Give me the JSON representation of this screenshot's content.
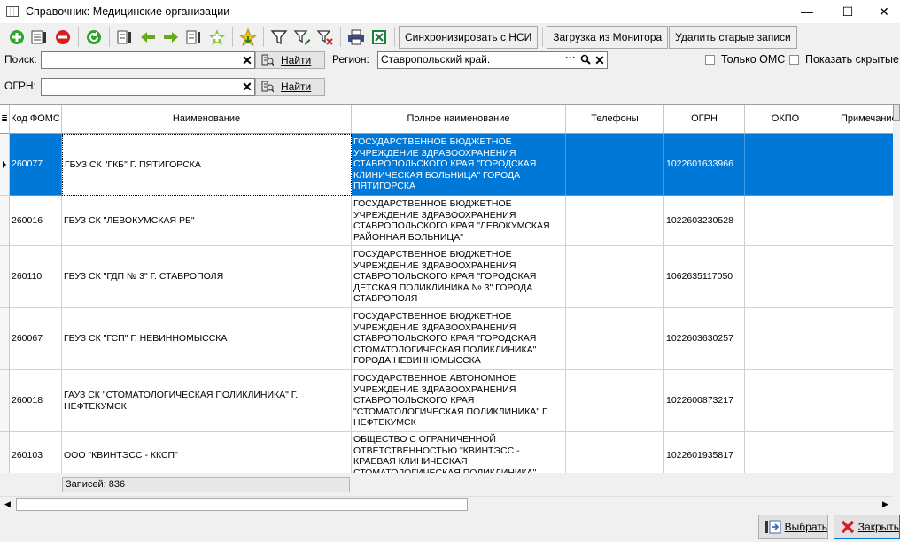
{
  "window": {
    "title": "Справочник: Медицинские организации",
    "minimize": "—",
    "maximize": "☐",
    "close": "✕"
  },
  "toolbar": {
    "sync_label": "Синхронизировать с НСИ",
    "monitor_label": "Загрузка из Монитора",
    "delete_old_label": "Удалить старые записи"
  },
  "filters": {
    "search_label": "Поиск:",
    "search_value": "",
    "find_label": "Найти",
    "region_label": "Регион:",
    "region_value": "Ставропольский край.",
    "region_dots": "···",
    "only_oms_label": "Только ОМС",
    "show_hidden_label": "Показать скрытые",
    "ogrn_label": "ОГРН:",
    "ogrn_value": "",
    "find2_label": "Найти"
  },
  "table": {
    "columns": [
      "Код ФОМС",
      "Наименование",
      "Полное наименование",
      "Телефоны",
      "ОГРН",
      "ОКПО",
      "Примечание"
    ],
    "rows": [
      {
        "code": "260077",
        "name": "ГБУЗ СК \"ГКБ\" Г. ПЯТИГОРСКА",
        "full": "ГОСУДАРСТВЕННОЕ БЮДЖЕТНОЕ УЧРЕЖДЕНИЕ ЗДРАВООХРАНЕНИЯ СТАВРОПОЛЬСКОГО КРАЯ \"ГОРОДСКАЯ КЛИНИЧЕСКАЯ БОЛЬНИЦА\" ГОРОДА ПЯТИГОРСКА",
        "phones": "",
        "ogrn": "1022601633966",
        "okpo": "",
        "note": ""
      },
      {
        "code": "260016",
        "name": "ГБУЗ СК \"ЛЕВОКУМСКАЯ РБ\"",
        "full": "ГОСУДАРСТВЕННОЕ БЮДЖЕТНОЕ УЧРЕЖДЕНИЕ ЗДРАВООХРАНЕНИЯ СТАВРОПОЛЬСКОГО КРАЯ \"ЛЕВОКУМСКАЯ РАЙОННАЯ БОЛЬНИЦА\"",
        "phones": "",
        "ogrn": "1022603230528",
        "okpo": "",
        "note": ""
      },
      {
        "code": "260110",
        "name": "ГБУЗ СК \"ГДП № 3\" Г. СТАВРОПОЛЯ",
        "full": "ГОСУДАРСТВЕННОЕ БЮДЖЕТНОЕ УЧРЕЖДЕНИЕ ЗДРАВООХРАНЕНИЯ СТАВРОПОЛЬСКОГО КРАЯ \"ГОРОДСКАЯ ДЕТСКАЯ ПОЛИКЛИНИКА № 3\" ГОРОДА СТАВРОПОЛЯ",
        "phones": "",
        "ogrn": "1062635117050",
        "okpo": "",
        "note": ""
      },
      {
        "code": "260067",
        "name": "ГБУЗ СК \"ГСП\" Г. НЕВИННОМЫССКА",
        "full": "ГОСУДАРСТВЕННОЕ БЮДЖЕТНОЕ УЧРЕЖДЕНИЕ ЗДРАВООХРАНЕНИЯ СТАВРОПОЛЬСКОГО КРАЯ \"ГОРОДСКАЯ СТОМАТОЛОГИЧЕСКАЯ ПОЛИКЛИНИКА\" ГОРОДА НЕВИННОМЫССКА",
        "phones": "",
        "ogrn": "1022603630257",
        "okpo": "",
        "note": ""
      },
      {
        "code": "260018",
        "name": "ГАУЗ СК \"СТОМАТОЛОГИЧЕСКАЯ ПОЛИКЛИНИКА\" Г. НЕФТЕКУМСК",
        "full": "ГОСУДАРСТВЕННОЕ АВТОНОМНОЕ УЧРЕЖДЕНИЕ ЗДРАВООХРАНЕНИЯ СТАВРОПОЛЬСКОГО КРАЯ \"СТОМАТОЛОГИЧЕСКАЯ ПОЛИКЛИНИКА\" Г. НЕФТЕКУМСК",
        "phones": "",
        "ogrn": "1022600873217",
        "okpo": "",
        "note": ""
      },
      {
        "code": "260103",
        "name": "ООО \"КВИНТЭСС - ККСП\"",
        "full": "ОБЩЕСТВО С ОГРАНИЧЕННОЙ ОТВЕТСТВЕННОСТЬЮ \"КВИНТЭСС - КРАЕВАЯ КЛИНИЧЕСКАЯ СТОМАТОЛОГИЧЕСКАЯ ПОЛИКЛИНИКА\"",
        "phones": "",
        "ogrn": "1022601935817",
        "okpo": "",
        "note": ""
      }
    ]
  },
  "footer": {
    "records": "Записей: 836"
  },
  "buttons": {
    "select_label": "Выбрать",
    "close_label": "Закрыть"
  },
  "colors": {
    "selection": "#0078d7",
    "green": "#2aa52a",
    "red": "#d62020"
  }
}
